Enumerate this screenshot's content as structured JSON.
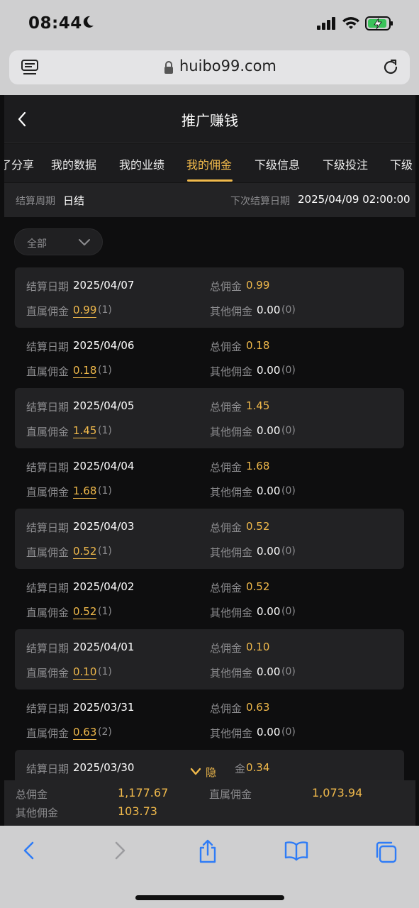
{
  "status": {
    "time": "08:44"
  },
  "browser": {
    "url": "huibo99.com"
  },
  "header": {
    "title": "推广赚钱"
  },
  "tabs": [
    "了分享",
    "我的数据",
    "我的业绩",
    "我的佣金",
    "下级信息",
    "下级投注",
    "下级"
  ],
  "active_tab": "我的佣金",
  "period": {
    "label": "结算周期",
    "value": "日结",
    "next_label": "下次结算日期",
    "next_value": "2025/04/09 02:00:00"
  },
  "filter": {
    "selected": "全部"
  },
  "labels": {
    "date": "结算日期",
    "total": "总佣金",
    "direct": "直属佣金",
    "other": "其他佣金"
  },
  "records": [
    {
      "date": "2025/04/07",
      "total": "0.99",
      "direct": "0.99",
      "direct_count": "(1)",
      "other": "0.00",
      "other_count": "(0)"
    },
    {
      "date": "2025/04/06",
      "total": "0.18",
      "direct": "0.18",
      "direct_count": "(1)",
      "other": "0.00",
      "other_count": "(0)"
    },
    {
      "date": "2025/04/05",
      "total": "1.45",
      "direct": "1.45",
      "direct_count": "(1)",
      "other": "0.00",
      "other_count": "(0)"
    },
    {
      "date": "2025/04/04",
      "total": "1.68",
      "direct": "1.68",
      "direct_count": "(1)",
      "other": "0.00",
      "other_count": "(0)"
    },
    {
      "date": "2025/04/03",
      "total": "0.52",
      "direct": "0.52",
      "direct_count": "(1)",
      "other": "0.00",
      "other_count": "(0)"
    },
    {
      "date": "2025/04/02",
      "total": "0.52",
      "direct": "0.52",
      "direct_count": "(1)",
      "other": "0.00",
      "other_count": "(0)"
    },
    {
      "date": "2025/04/01",
      "total": "0.10",
      "direct": "0.10",
      "direct_count": "(1)",
      "other": "0.00",
      "other_count": "(0)"
    },
    {
      "date": "2025/03/31",
      "total": "0.63",
      "direct": "0.63",
      "direct_count": "(2)",
      "other": "0.00",
      "other_count": "(0)"
    },
    {
      "date": "2025/03/30",
      "total": "0.34"
    }
  ],
  "partial_row_label_fragment": "金",
  "hide_label": "隐藏",
  "summary": {
    "total_label": "总佣金",
    "total_value": "1,177.67",
    "direct_label": "直属佣金",
    "direct_value": "1,073.94",
    "other_label": "其他佣金",
    "other_value": "103.73"
  },
  "colors": {
    "accent": "#f0b94b",
    "ios_blue": "#2f7cf6"
  },
  "icons": [
    "moon-icon",
    "signal-icon",
    "wifi-icon",
    "battery-charging-icon",
    "tab-overview-icon",
    "lock-icon",
    "reload-icon",
    "back-icon",
    "chevron-down-icon",
    "browser-back-icon",
    "browser-forward-icon",
    "share-icon",
    "bookmarks-icon",
    "tabs-icon"
  ]
}
